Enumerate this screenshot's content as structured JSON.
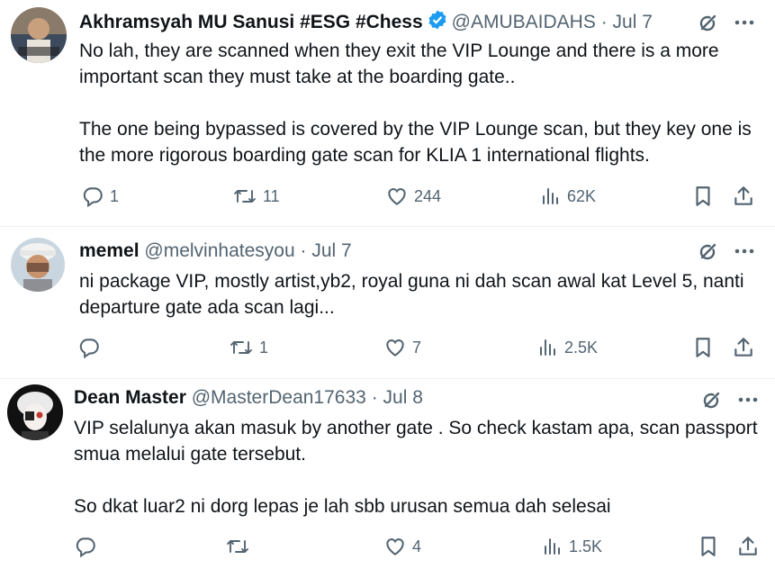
{
  "tweets": [
    {
      "name": "Akhramsyah MU Sanusi #ESG #Chess",
      "verified": true,
      "handle": "@AMUBAIDAHS",
      "separator": "·",
      "date": "Jul 7",
      "text": "No lah, they are scanned when they exit the VIP Lounge and there is a more important scan they must take at the boarding gate..\n\nThe one being bypassed is covered by the VIP Lounge scan, but they key one is the more rigorous boarding gate scan for KLIA 1 international flights.",
      "replies": "1",
      "reposts": "11",
      "likes": "244",
      "views": "62K"
    },
    {
      "name": "memel",
      "verified": false,
      "handle": "@melvinhatesyou",
      "separator": "·",
      "date": "Jul 7",
      "text": "ni package VIP, mostly artist,yb2, royal guna ni dah scan awal kat Level 5, nanti departure gate ada scan lagi...",
      "replies": "",
      "reposts": "1",
      "likes": "7",
      "views": "2.5K"
    },
    {
      "name": "Dean Master",
      "verified": false,
      "handle": "@MasterDean17633",
      "separator": "·",
      "date": "Jul 8",
      "text": "VIP selalunya akan masuk by another gate . So check kastam apa, scan passport smua melalui gate tersebut.\n\nSo dkat luar2 ni dorg lepas je lah sbb urusan semua dah selesai",
      "replies": "",
      "reposts": "",
      "likes": "4",
      "views": "1.5K"
    }
  ],
  "icons": {
    "verified": "verified-badge-icon",
    "grok": "grok-icon",
    "more": "more-options-icon",
    "reply": "reply-icon",
    "repost": "repost-icon",
    "like": "heart-icon",
    "views": "views-icon",
    "bookmark": "bookmark-icon",
    "share": "share-icon"
  },
  "colors": {
    "text": "#0f1419",
    "secondary": "#536471",
    "verified": "#1d9bf0"
  }
}
